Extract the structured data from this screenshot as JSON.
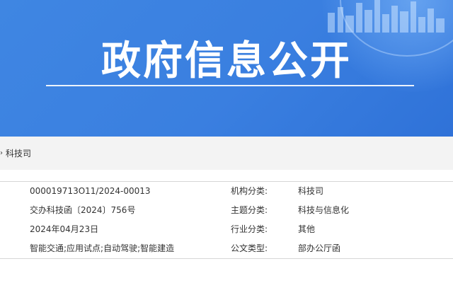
{
  "banner": {
    "title": "政府信息公开"
  },
  "breadcrumb": {
    "separator": "›",
    "current": "科技司"
  },
  "info": {
    "rows": [
      {
        "value1": "000019713O11/2024-00013",
        "label2": "机构分类:",
        "value2": "科技司"
      },
      {
        "value1": "交办科技函〔2024〕756号",
        "label2": "主题分类:",
        "value2": "科技与信息化"
      },
      {
        "value1": "2024年04月23日",
        "label2": "行业分类:",
        "value2": "其他"
      },
      {
        "value1": "智能交通;应用试点;自动驾驶;智能建造",
        "label2": "公文类型:",
        "value2": "部办公厅函"
      }
    ]
  }
}
